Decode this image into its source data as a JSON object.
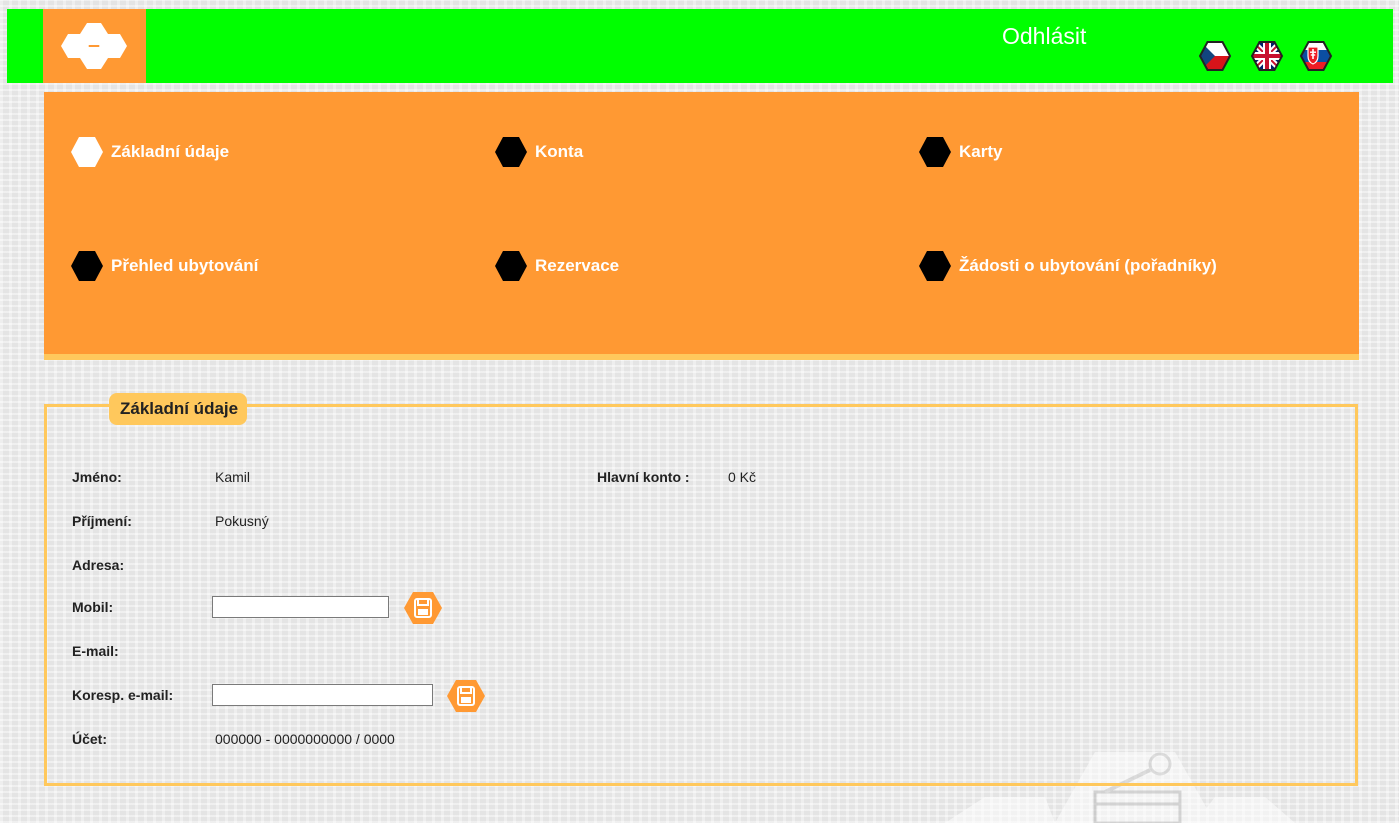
{
  "header": {
    "logo_label": "logo",
    "logout_label": "Odhlásit",
    "languages": [
      {
        "code": "cs",
        "icon": "czech-flag-icon"
      },
      {
        "code": "en",
        "icon": "uk-flag-icon"
      },
      {
        "code": "sk",
        "icon": "slovak-flag-icon"
      }
    ],
    "colors": {
      "topbar": "#00ff00",
      "logo_bg": "#ff9933"
    }
  },
  "menu": {
    "background": "#ff9933",
    "items": [
      {
        "label": "Základní údaje",
        "active": true
      },
      {
        "label": "Konta",
        "active": false
      },
      {
        "label": "Karty",
        "active": false
      },
      {
        "label": "Přehled ubytování",
        "active": false
      },
      {
        "label": "Rezervace",
        "active": false
      },
      {
        "label": "Žádosti o ubytování (pořadníky)",
        "active": false
      }
    ]
  },
  "panel": {
    "title": "Základní údaje",
    "fields": {
      "jmeno": {
        "label": "Jméno:",
        "value": "Kamil"
      },
      "prijmeni": {
        "label": "Příjmení:",
        "value": "Pokusný"
      },
      "adresa": {
        "label": "Adresa:",
        "value": ""
      },
      "mobil": {
        "label": "Mobil:",
        "value": "",
        "icon": "save-icon"
      },
      "email": {
        "label": "E-mail:",
        "value": ""
      },
      "koresp_email": {
        "label": "Koresp. e-mail:",
        "value": "",
        "icon": "save-icon"
      },
      "ucet": {
        "label": "Účet:",
        "value": "000000 - 0000000000 / 0000"
      }
    },
    "main_account": {
      "label": "Hlavní konto :",
      "value": "0 Kč"
    },
    "accent": "#ffc85c"
  }
}
